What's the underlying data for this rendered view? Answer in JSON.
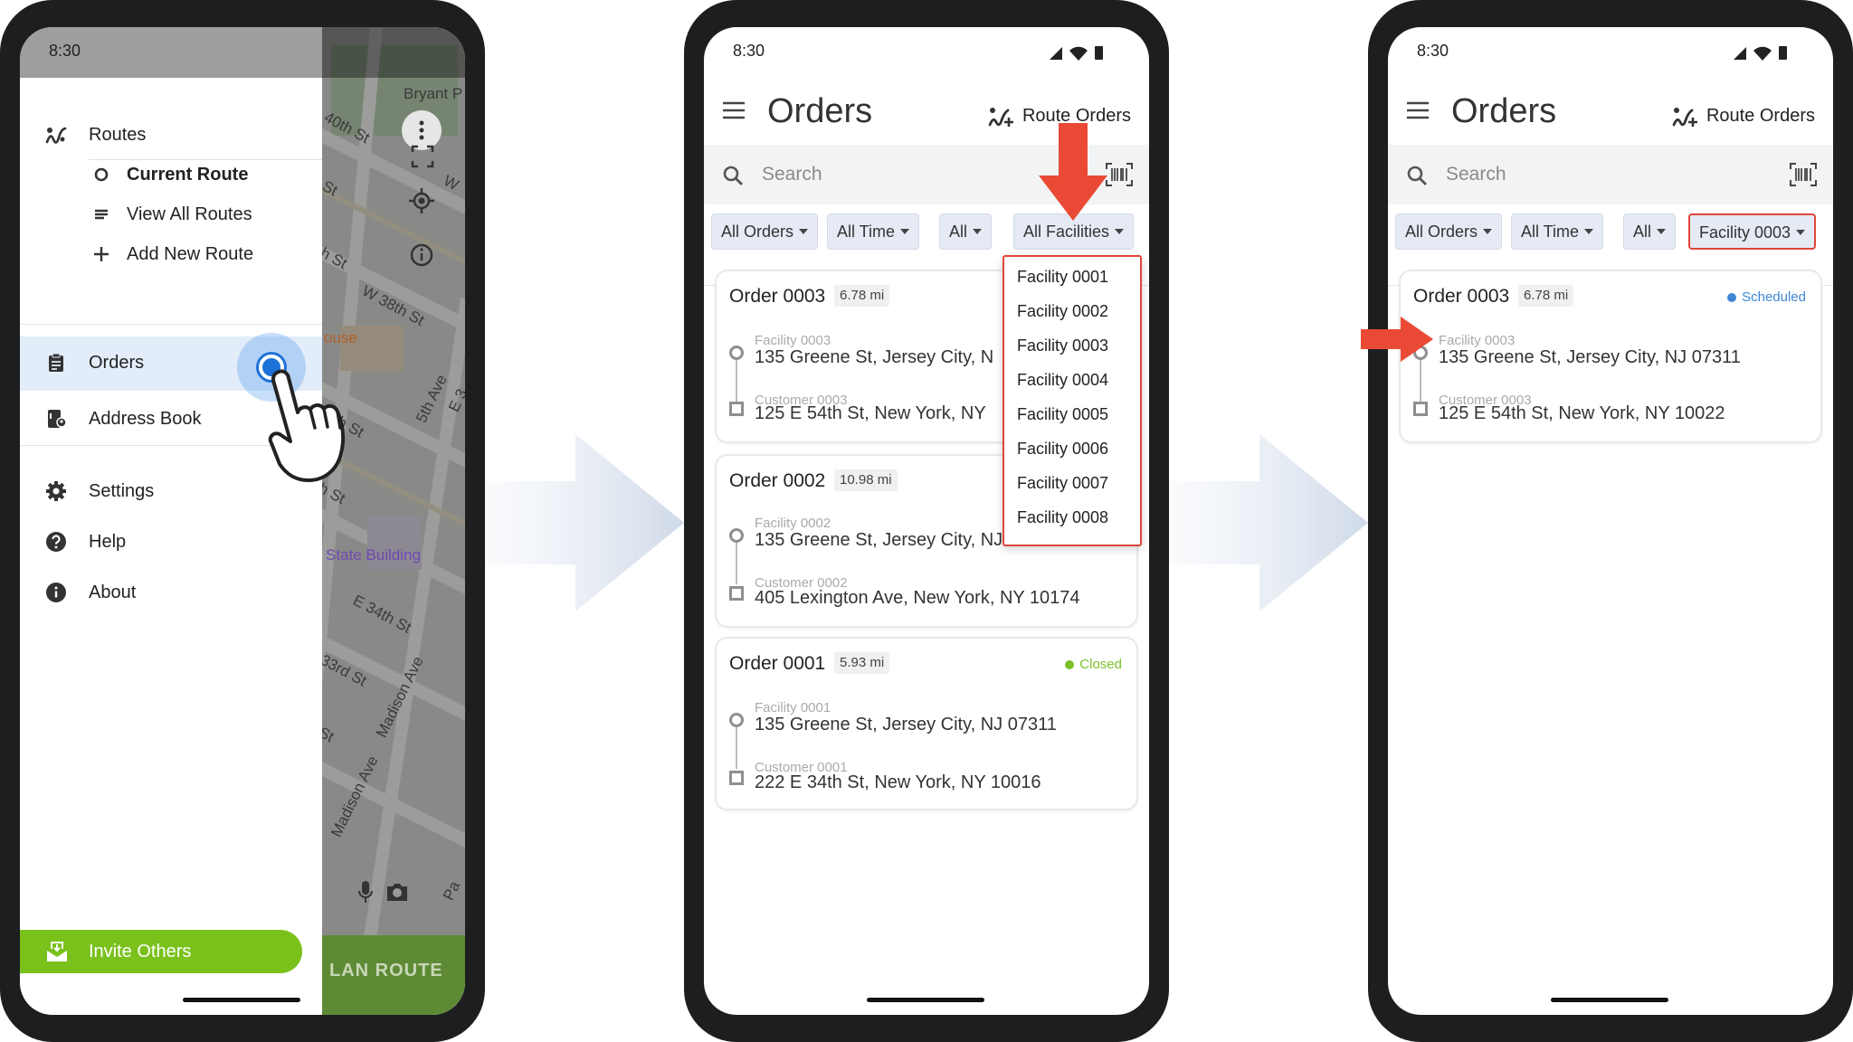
{
  "phone1": {
    "status_time": "8:30",
    "map_labels": [
      "Bryant P",
      "40th St",
      "St",
      "W",
      "h St",
      "W 38th St",
      "ouse",
      "5th Ave",
      "E 3",
      "6th St",
      "h St",
      "State Building",
      "E 34th St",
      "33rd St",
      "Madison Ave",
      "St",
      "Madison Ave",
      "Pa"
    ],
    "map_bottom_label": "LAN ROUTE",
    "drawer": {
      "items": [
        {
          "label": "Routes",
          "icon": "routes-icon"
        },
        {
          "label": "Current Route",
          "icon": "circle-outline-icon"
        },
        {
          "label": "View All Routes",
          "icon": "list-icon"
        },
        {
          "label": "Add New Route",
          "icon": "plus-icon"
        },
        {
          "label": "Orders",
          "icon": "clipboard-icon"
        },
        {
          "label": "Address Book",
          "icon": "address-book-icon"
        },
        {
          "label": "Settings",
          "icon": "gear-icon"
        },
        {
          "label": "Help",
          "icon": "help-icon"
        },
        {
          "label": "About",
          "icon": "info-icon"
        }
      ],
      "active_item": "Orders",
      "invite_label": "Invite Others"
    }
  },
  "phone2": {
    "status_time": "8:30",
    "title": "Orders",
    "route_orders_label": "Route Orders",
    "search_placeholder": "Search",
    "filters": [
      "All Orders",
      "All Time",
      "All",
      "All Facilities"
    ],
    "dropdown_options": [
      "Facility 0001",
      "Facility 0002",
      "Facility 0003",
      "Facility 0004",
      "Facility 0005",
      "Facility 0006",
      "Facility 0007",
      "Facility 0008"
    ],
    "orders": [
      {
        "title": "Order 0003",
        "distance": "6.78 mi",
        "status": "",
        "pickup_name": "Facility 0003",
        "pickup_address": "135 Greene St, Jersey City, N",
        "drop_name": "Customer 0003",
        "drop_address": "125 E 54th St, New York, NY"
      },
      {
        "title": "Order 0002",
        "distance": "10.98 mi",
        "status": "",
        "pickup_name": "Facility 0002",
        "pickup_address": "135 Greene St, Jersey City, NJ 07311",
        "drop_name": "Customer 0002",
        "drop_address": "405 Lexington Ave, New York, NY 10174"
      },
      {
        "title": "Order 0001",
        "distance": "5.93 mi",
        "status": "Closed",
        "pickup_name": "Facility 0001",
        "pickup_address": "135 Greene St, Jersey City, NJ 07311",
        "drop_name": "Customer 0001",
        "drop_address": "222 E 34th St, New York, NY 10016"
      }
    ]
  },
  "phone3": {
    "status_time": "8:30",
    "title": "Orders",
    "route_orders_label": "Route Orders",
    "search_placeholder": "Search",
    "filters": [
      "All Orders",
      "All Time",
      "All",
      "Facility 0003"
    ],
    "orders": [
      {
        "title": "Order 0003",
        "distance": "6.78 mi",
        "status": "Scheduled",
        "pickup_name": "Facility 0003",
        "pickup_address": "135 Greene St, Jersey City, NJ 07311",
        "drop_name": "Customer 0003",
        "drop_address": "125 E 54th St, New York, NY 10022"
      }
    ]
  },
  "colors": {
    "accent_green": "#7ac11c",
    "active_blue": "#1d72d8",
    "highlight_red": "#e0463a",
    "closed_green": "#7cc12a",
    "scheduled_blue": "#3f87d6",
    "chip_bg": "#e5eaf4"
  }
}
